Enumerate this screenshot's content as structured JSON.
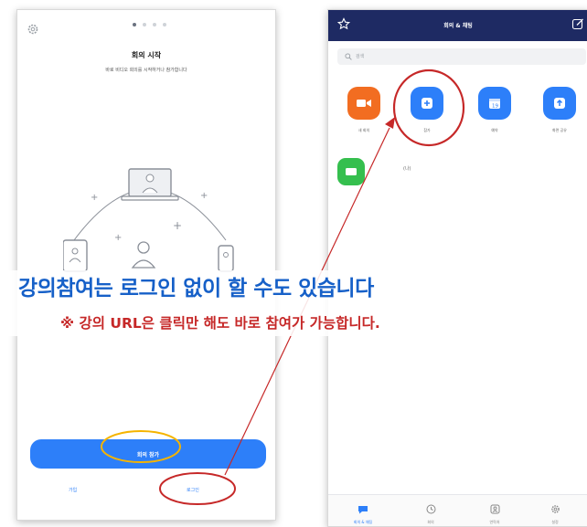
{
  "left_screen": {
    "title": "회의 시작",
    "subtitle": "바로 비디오 회의를 시작하거나 참가합니다",
    "join_button_label": "회의 참가",
    "signup_label": "가입",
    "login_label": "로그인",
    "pager_total": 4,
    "pager_active": 1
  },
  "right_screen": {
    "header_title": "회의 & 채팅",
    "search_placeholder": "검색",
    "actions": [
      {
        "label": "새 회의",
        "icon": "video-camera-icon",
        "color": "#f26d21"
      },
      {
        "label": "참가",
        "icon": "plus-icon",
        "color": "#2d7ff9"
      },
      {
        "label": "예약",
        "icon": "calendar-icon",
        "color": "#2d7ff9"
      },
      {
        "label": "화면 공유",
        "icon": "share-screen-icon",
        "color": "#2d7ff9"
      }
    ],
    "pmi_label": "(나)",
    "tabs": [
      {
        "label": "회의 & 채팅",
        "icon": "chat-bubble-icon",
        "active": true
      },
      {
        "label": "회의",
        "icon": "clock-icon",
        "active": false
      },
      {
        "label": "연락처",
        "icon": "contact-icon",
        "active": false
      },
      {
        "label": "설정",
        "icon": "gear-icon",
        "active": false
      }
    ]
  },
  "caption": {
    "main": "강의참여는 로그인 없이 할 수도 있습니다",
    "sub": "※ 강의 URL은 클릭만 해도 바로 참여가 가능합니다."
  },
  "colors": {
    "zoom_blue": "#2d7ff9",
    "header_navy": "#1e2a63",
    "annotation_red": "#c62828",
    "annotation_yellow": "#f5b400",
    "caption_blue": "#1660c8"
  }
}
